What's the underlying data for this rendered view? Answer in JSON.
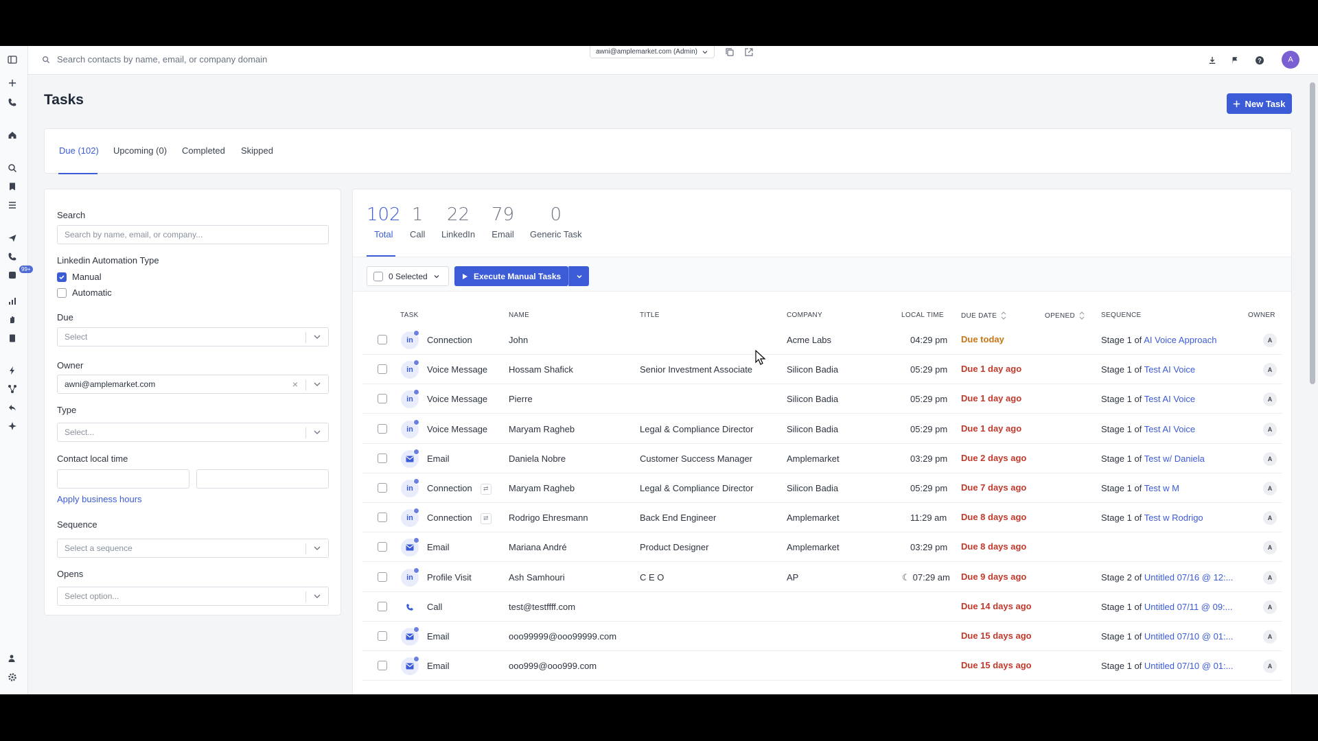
{
  "topbar": {
    "search_placeholder": "Search contacts by name, email, or company domain",
    "account": "awni@amplemarket.com (Admin)",
    "avatar": "A"
  },
  "page": {
    "title": "Tasks",
    "new_task": "New Task"
  },
  "rail": {
    "badge": "99+"
  },
  "tabs": [
    {
      "label": "Due (102)"
    },
    {
      "label": "Upcoming (0)"
    },
    {
      "label": "Completed"
    },
    {
      "label": "Skipped"
    }
  ],
  "filters": {
    "search_label": "Search",
    "search_placeholder": "Search by name, email, or company...",
    "linkedin_label": "Linkedin Automation Type",
    "manual": "Manual",
    "automatic": "Automatic",
    "due_label": "Due",
    "due_placeholder": "Select",
    "owner_label": "Owner",
    "owner_value": "awni@amplemarket.com",
    "type_label": "Type",
    "type_placeholder": "Select...",
    "local_time_label": "Contact local time",
    "apply_hours": "Apply business hours",
    "sequence_label": "Sequence",
    "sequence_placeholder": "Select a sequence",
    "opens_label": "Opens",
    "opens_placeholder": "Select option..."
  },
  "stats": [
    {
      "num": "102",
      "label": "Total"
    },
    {
      "num": "1",
      "label": "Call"
    },
    {
      "num": "22",
      "label": "LinkedIn"
    },
    {
      "num": "79",
      "label": "Email"
    },
    {
      "num": "0",
      "label": "Generic Task"
    }
  ],
  "toolbar": {
    "selected": "0 Selected",
    "execute": "Execute Manual Tasks"
  },
  "columns": {
    "task": "TASK",
    "name": "NAME",
    "title": "TITLE",
    "company": "COMPANY",
    "local_time": "LOCAL TIME",
    "due_date": "DUE DATE",
    "opened": "OPENED",
    "sequence": "SEQUENCE",
    "owner": "OWNER"
  },
  "rows": [
    {
      "icon": "linkedin",
      "task": "Connection",
      "name": "John",
      "title": "",
      "company": "Acme Labs",
      "time": "04:29 pm",
      "due": "Due today",
      "stage": "Stage 1",
      "of": "of",
      "seq": "AI Voice Approach",
      "owner": "A"
    },
    {
      "icon": "linkedin",
      "task": "Voice Message",
      "name": "Hossam Shafick",
      "title": "Senior Investment Associate",
      "company": "Silicon Badia",
      "time": "05:29 pm",
      "due": "Due 1 day ago",
      "stage": "Stage 1",
      "of": "of",
      "seq": "Test AI Voice",
      "owner": "A"
    },
    {
      "icon": "linkedin",
      "task": "Voice Message",
      "name": "Pierre",
      "title": "",
      "company": "Silicon Badia",
      "time": "05:29 pm",
      "due": "Due 1 day ago",
      "stage": "Stage 1",
      "of": "of",
      "seq": "Test AI Voice",
      "owner": "A"
    },
    {
      "icon": "linkedin",
      "task": "Voice Message",
      "name": "Maryam Ragheb",
      "title": "Legal & Compliance Director",
      "company": "Silicon Badia",
      "time": "05:29 pm",
      "due": "Due 1 day ago",
      "stage": "Stage 1",
      "of": "of",
      "seq": "Test AI Voice",
      "owner": "A"
    },
    {
      "icon": "email",
      "task": "Email",
      "name": "Daniela Nobre",
      "title": "Customer Success Manager",
      "company": "Amplemarket",
      "time": "03:29 pm",
      "due": "Due 2 days ago",
      "stage": "Stage 1",
      "of": "of",
      "seq": "Test w/ Daniela",
      "owner": "A"
    },
    {
      "icon": "linkedin",
      "task": "Connection",
      "name": "Maryam Ragheb",
      "title": "Legal & Compliance Director",
      "company": "Silicon Badia",
      "time": "05:29 pm",
      "due": "Due 7 days ago",
      "stage": "Stage 1",
      "of": "of",
      "seq": "Test w M",
      "owner": "A",
      "sub": true
    },
    {
      "icon": "linkedin",
      "task": "Connection",
      "name": "Rodrigo Ehresmann",
      "title": "Back End Engineer",
      "company": "Amplemarket",
      "time": "11:29 am",
      "due": "Due 8 days ago",
      "stage": "Stage 1",
      "of": "of",
      "seq": "Test w Rodrigo",
      "owner": "A",
      "sub": true
    },
    {
      "icon": "email",
      "task": "Email",
      "name": "Mariana André",
      "title": "Product Designer",
      "company": "Amplemarket",
      "time": "03:29 pm",
      "due": "Due 8 days ago",
      "stage": "",
      "of": "",
      "seq": "",
      "owner": "A"
    },
    {
      "icon": "linkedin",
      "task": "Profile Visit",
      "name": "Ash Samhouri",
      "title": "C E O",
      "company": "AP",
      "time": "07:29 am",
      "due": "Due 9 days ago",
      "stage": "Stage 2",
      "of": "of",
      "seq": "Untitled 07/16 @ 12:...",
      "owner": "A",
      "moon": true
    },
    {
      "icon": "call",
      "task": "Call",
      "name": "test@testffff.com",
      "title": "",
      "company": "",
      "time": "",
      "due": "Due 14 days ago",
      "stage": "Stage 1",
      "of": "of",
      "seq": "Untitled 07/11 @ 09:...",
      "owner": "A"
    },
    {
      "icon": "email",
      "task": "Email",
      "name": "ooo99999@ooo99999.com",
      "title": "",
      "company": "",
      "time": "",
      "due": "Due 15 days ago",
      "stage": "Stage 1",
      "of": "of",
      "seq": "Untitled 07/10 @ 01:...",
      "owner": "A"
    },
    {
      "icon": "email",
      "task": "Email",
      "name": "ooo999@ooo999.com",
      "title": "",
      "company": "",
      "time": "",
      "due": "Due 15 days ago",
      "stage": "Stage 1",
      "of": "of",
      "seq": "Untitled 07/10 @ 01:...",
      "owner": "A"
    }
  ],
  "colors": {
    "accent": "#3c5bd6",
    "due_overdue": "#c0392b",
    "due_today": "#c87514"
  }
}
